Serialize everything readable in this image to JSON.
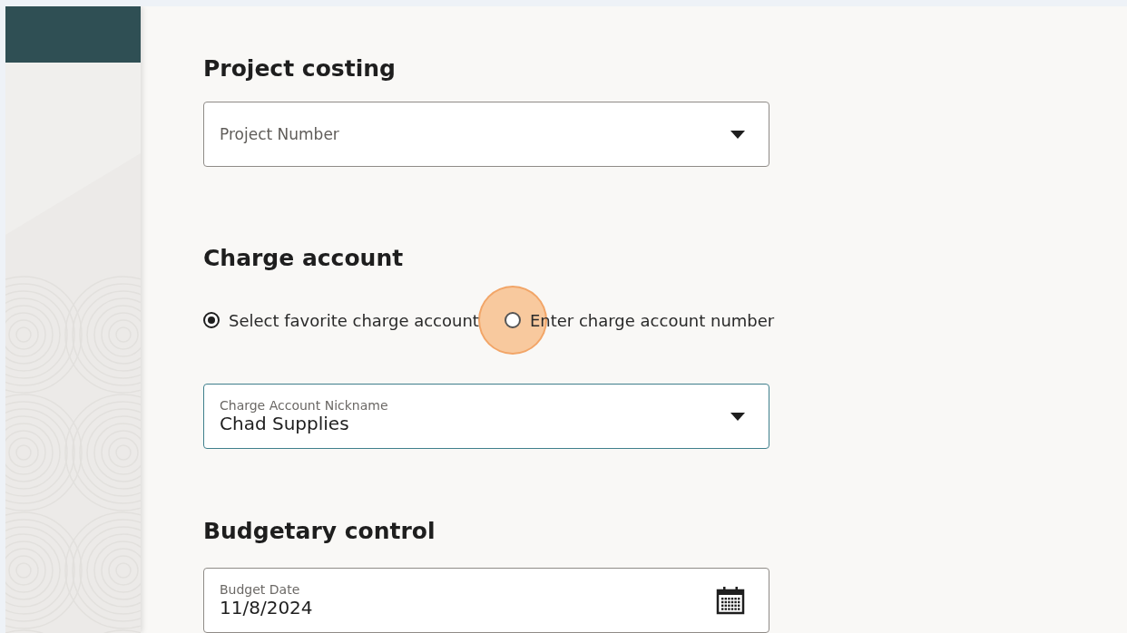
{
  "project_costing": {
    "heading": "Project costing",
    "project_number": {
      "placeholder": "Project Number"
    }
  },
  "charge_account": {
    "heading": "Charge account",
    "options": [
      {
        "label": "Select favorite charge account",
        "selected": true,
        "highlighted": false
      },
      {
        "label": "Enter charge account number",
        "selected": false,
        "highlighted": true
      }
    ],
    "nickname": {
      "label": "Charge Account Nickname",
      "value": "Chad Supplies",
      "focused": true
    }
  },
  "budgetary_control": {
    "heading": "Budgetary control",
    "budget_date": {
      "label": "Budget Date",
      "value": "11/8/2024"
    }
  }
}
